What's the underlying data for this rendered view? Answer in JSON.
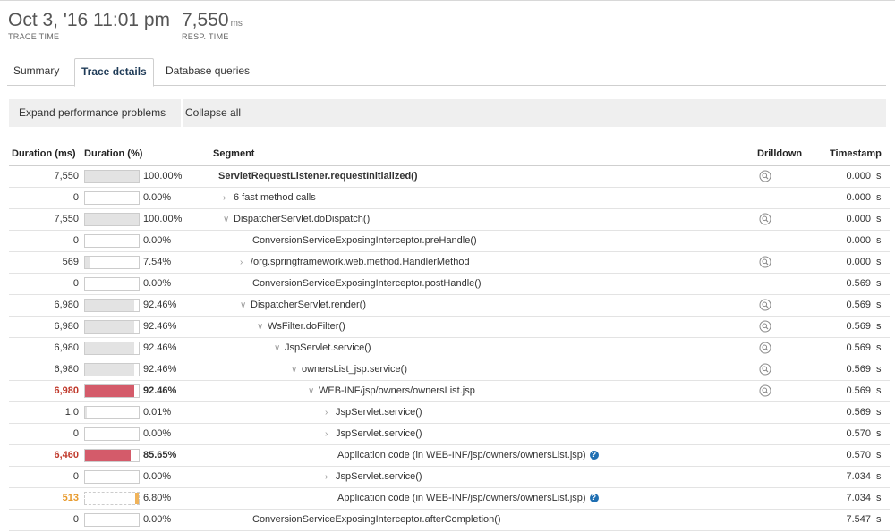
{
  "header": {
    "trace_time_value": "Oct 3, '16 11:01 pm",
    "trace_time_label": "TRACE TIME",
    "resp_time_value": "7,550",
    "resp_time_unit": "ms",
    "resp_time_label": "RESP. TIME"
  },
  "tabs": [
    {
      "label": "Summary",
      "active": false
    },
    {
      "label": "Trace details",
      "active": true
    },
    {
      "label": "Database queries",
      "active": false
    }
  ],
  "toolbar": {
    "expand_label": "Expand performance problems",
    "collapse_label": "Collapse all"
  },
  "columns": {
    "duration_ms": "Duration (ms)",
    "duration_pct": "Duration (%)",
    "segment": "Segment",
    "drilldown": "Drilldown",
    "timestamp": "Timestamp"
  },
  "rows": [
    {
      "ms": "7,550",
      "pct": "100.00%",
      "fraction": 1.0,
      "segment": "ServletRequestListener.requestInitialized()",
      "depth": 0,
      "chevron": "",
      "drill": true,
      "ts": "0.000",
      "unit": "s",
      "style": "bold",
      "help": false
    },
    {
      "ms": "0",
      "pct": "0.00%",
      "fraction": 0,
      "segment": "6 fast method calls",
      "depth": 1,
      "chevron": "right",
      "drill": false,
      "ts": "0.000",
      "unit": "s",
      "style": "",
      "help": false
    },
    {
      "ms": "7,550",
      "pct": "100.00%",
      "fraction": 1.0,
      "segment": "DispatcherServlet.doDispatch()",
      "depth": 1,
      "chevron": "down",
      "drill": true,
      "ts": "0.000",
      "unit": "s",
      "style": "",
      "help": false
    },
    {
      "ms": "0",
      "pct": "0.00%",
      "fraction": 0,
      "segment": "ConversionServiceExposingInterceptor.preHandle()",
      "depth": 2,
      "chevron": "",
      "drill": false,
      "ts": "0.000",
      "unit": "s",
      "style": "",
      "help": false
    },
    {
      "ms": "569",
      "pct": "7.54%",
      "fraction": 0.0754,
      "segment": "/org.springframework.web.method.HandlerMethod",
      "depth": 2,
      "chevron": "right",
      "drill": true,
      "ts": "0.000",
      "unit": "s",
      "style": "",
      "help": false
    },
    {
      "ms": "0",
      "pct": "0.00%",
      "fraction": 0,
      "segment": "ConversionServiceExposingInterceptor.postHandle()",
      "depth": 2,
      "chevron": "",
      "drill": false,
      "ts": "0.569",
      "unit": "s",
      "style": "",
      "help": false
    },
    {
      "ms": "6,980",
      "pct": "92.46%",
      "fraction": 0.9246,
      "segment": "DispatcherServlet.render()",
      "depth": 2,
      "chevron": "down",
      "drill": true,
      "ts": "0.569",
      "unit": "s",
      "style": "",
      "help": false
    },
    {
      "ms": "6,980",
      "pct": "92.46%",
      "fraction": 0.9246,
      "segment": "WsFilter.doFilter()",
      "depth": 3,
      "chevron": "down",
      "drill": true,
      "ts": "0.569",
      "unit": "s",
      "style": "",
      "help": false
    },
    {
      "ms": "6,980",
      "pct": "92.46%",
      "fraction": 0.9246,
      "segment": "JspServlet.service()",
      "depth": 4,
      "chevron": "down",
      "drill": true,
      "ts": "0.569",
      "unit": "s",
      "style": "",
      "help": false
    },
    {
      "ms": "6,980",
      "pct": "92.46%",
      "fraction": 0.9246,
      "segment": "ownersList_jsp.service()",
      "depth": 5,
      "chevron": "down",
      "drill": true,
      "ts": "0.569",
      "unit": "s",
      "style": "",
      "help": false
    },
    {
      "ms": "6,980",
      "pct": "92.46%",
      "fraction": 0.9246,
      "segment": "WEB-INF/jsp/owners/ownersList.jsp",
      "depth": 6,
      "chevron": "down",
      "drill": true,
      "ts": "0.569",
      "unit": "s",
      "style": "hot",
      "help": false
    },
    {
      "ms": "1.0",
      "pct": "0.01%",
      "fraction": 0.0001,
      "segment": "JspServlet.service()",
      "depth": 7,
      "chevron": "right",
      "drill": false,
      "ts": "0.569",
      "unit": "s",
      "style": "",
      "help": false
    },
    {
      "ms": "0",
      "pct": "0.00%",
      "fraction": 0,
      "segment": "JspServlet.service()",
      "depth": 7,
      "chevron": "right",
      "drill": false,
      "ts": "0.570",
      "unit": "s",
      "style": "",
      "help": false
    },
    {
      "ms": "6,460",
      "pct": "85.65%",
      "fraction": 0.8565,
      "segment": "Application code (in WEB-INF/jsp/owners/ownersList.jsp)",
      "depth": 7,
      "chevron": "",
      "drill": false,
      "ts": "0.570",
      "unit": "s",
      "style": "hot",
      "help": true
    },
    {
      "ms": "0",
      "pct": "0.00%",
      "fraction": 0,
      "segment": "JspServlet.service()",
      "depth": 7,
      "chevron": "right",
      "drill": false,
      "ts": "7.034",
      "unit": "s",
      "style": "",
      "help": false
    },
    {
      "ms": "513",
      "pct": "6.80%",
      "fraction": 0.068,
      "segment": "Application code (in WEB-INF/jsp/owners/ownersList.jsp)",
      "depth": 7,
      "chevron": "",
      "drill": false,
      "ts": "7.034",
      "unit": "s",
      "style": "warm",
      "help": true
    },
    {
      "ms": "0",
      "pct": "0.00%",
      "fraction": 0,
      "segment": "ConversionServiceExposingInterceptor.afterCompletion()",
      "depth": 2,
      "chevron": "",
      "drill": false,
      "ts": "7.547",
      "unit": "s",
      "style": "",
      "help": false
    }
  ]
}
